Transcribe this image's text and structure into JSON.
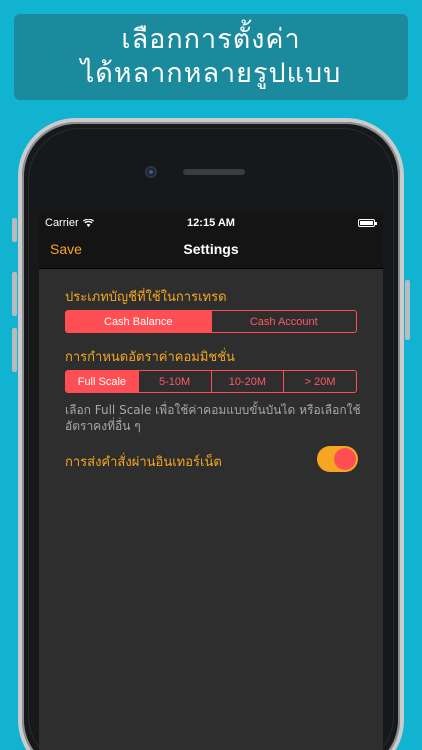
{
  "banner": {
    "line1": "เลือกการตั้งค่า",
    "line2": "ได้หลากหลายรูปแบบ"
  },
  "status_bar": {
    "carrier": "Carrier",
    "time": "12:15 AM"
  },
  "nav": {
    "save_label": "Save",
    "title": "Settings"
  },
  "settings": {
    "account_type_label": "ประเภทบัญชีที่ใช้ในการเทรด",
    "account_type_options": [
      "Cash Balance",
      "Cash Account"
    ],
    "account_type_selected": "Cash Balance",
    "commission_label": "การกำหนดอัตราค่าคอมมิชชั่น",
    "commission_options": [
      "Full Scale",
      "5-10M",
      "10-20M",
      "> 20M"
    ],
    "commission_selected": "Full Scale",
    "commission_help": "เลือก Full Scale เพื่อใช้ค่าคอมแบบขั้นบันได หรือเลือกใช้อัตราคงที่อื่น ๆ",
    "internet_order_label": "การส่งคำสั่งผ่านอินเทอร์เน็ต",
    "internet_order_enabled": true
  },
  "colors": {
    "accent_orange": "#f6a623",
    "accent_red": "#ff4f55",
    "background_cyan": "#12b3d0",
    "banner": "#1a8a9c"
  }
}
